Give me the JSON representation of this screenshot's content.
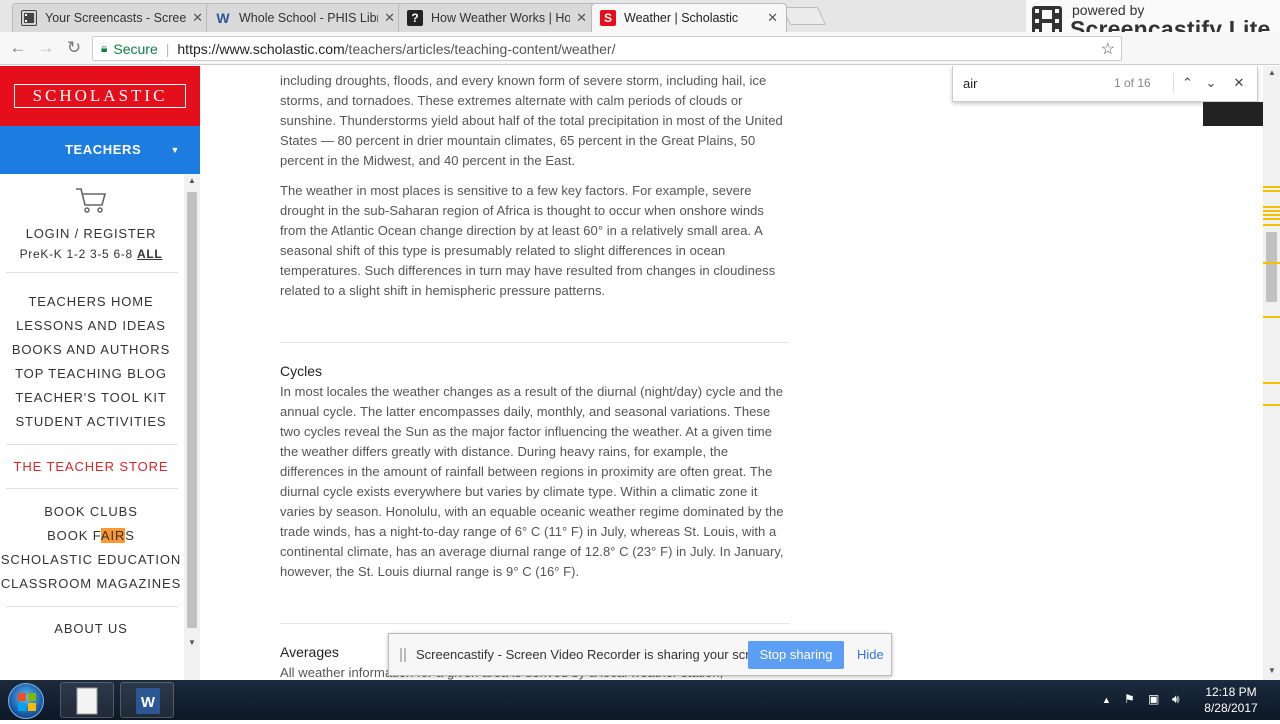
{
  "browser": {
    "tabs": [
      {
        "label": "Your Screencasts - Scree",
        "icon": "screencastify-icon",
        "active": false
      },
      {
        "label": "Whole School - PHIS Libr",
        "icon": "word-w-icon",
        "active": false
      },
      {
        "label": "How Weather Works | Ho",
        "icon": "howstuffworks-icon",
        "active": false
      },
      {
        "label": "Weather | Scholastic",
        "icon": "scholastic-s-icon",
        "active": true
      }
    ],
    "secure_label": "Secure",
    "url_main": "https://www.scholastic.com",
    "url_rest": "/teachers/articles/teaching-content/weather/"
  },
  "screencastify_brand": {
    "powered": "powered by",
    "name": "Screencastify Lite"
  },
  "find_bar": {
    "query": "air",
    "count": "1 of 16"
  },
  "sidebar": {
    "logo": "SCHOLASTIC",
    "teachers": "TEACHERS",
    "login": "LOGIN / REGISTER",
    "grades": "PreK-K 1-2 3-5 6-8",
    "grades_all": "ALL",
    "nav": [
      "TEACHERS HOME",
      "LESSONS AND IDEAS",
      "BOOKS AND AUTHORS",
      "TOP TEACHING BLOG",
      "TEACHER'S TOOL KIT",
      "STUDENT ACTIVITIES"
    ],
    "store": "THE TEACHER STORE",
    "nav2_clubs": "BOOK CLUBS",
    "fairs_pre": "BOOK F",
    "fairs_hl": "AIR",
    "fairs_post": "S",
    "nav2_rest": [
      "SCHOLASTIC EDUCATION",
      "CLASSROOM MAGAZINES"
    ],
    "about": "ABOUT US"
  },
  "article": {
    "para1": "including droughts, floods, and every known form of severe storm, including hail, ice storms, and tornadoes. These extremes alternate with calm periods of clouds or sunshine. Thunderstorms yield about half of the total precipitation in most of the United States — 80 percent in drier mountain climates, 65 percent in the Great Plains, 50 percent in the Midwest, and 40 percent in the East.",
    "para2": "The weather in most places is sensitive to a few key factors. For example, severe drought in the sub-Saharan region of Africa is thought to occur when onshore winds from the Atlantic Ocean change direction by at least 60° in a relatively small area. A seasonal shift of this type is presumably related to slight differences in ocean temperatures. Such differences in turn may have resulted from changes in cloudiness related to a slight shift in hemispheric pressure patterns.",
    "cycles_heading": "Cycles",
    "cycles_text": "In most locales the weather changes as a result of the diurnal (night/day) cycle and the annual cycle. The latter encompasses daily, monthly, and seasonal variations. These two cycles reveal the Sun as the major factor influencing the weather. At a given time the weather differs greatly with distance. During heavy rains, for example, the differences in the amount of rainfall between regions in proximity are often great. The diurnal cycle exists everywhere but varies by climate type. Within a climatic zone it varies by season. Honolulu, with an equable oceanic weather regime dominated by the trade winds, has a night-to-day range of 6° C (11° F) in July, whereas St. Louis, with a continental climate, has an average diurnal range of 12.8° C (23° F) in July. In January, however, the St. Louis diurnal range is 9° C (16° F).",
    "averages_heading": "Averages",
    "averages_text": "All weather information for a given area is derived by a local weather station,"
  },
  "notification": {
    "text": "Screencastify - Screen Video Recorder is sharing your screen.",
    "stop": "Stop sharing",
    "hide": "Hide"
  },
  "taskbar": {
    "time": "12:18 PM",
    "date": "8/28/2017"
  },
  "colors": {
    "scholastic_red": "#e50f1b",
    "teachers_blue": "#1c7ce0",
    "find_highlight": "#ff9632"
  }
}
